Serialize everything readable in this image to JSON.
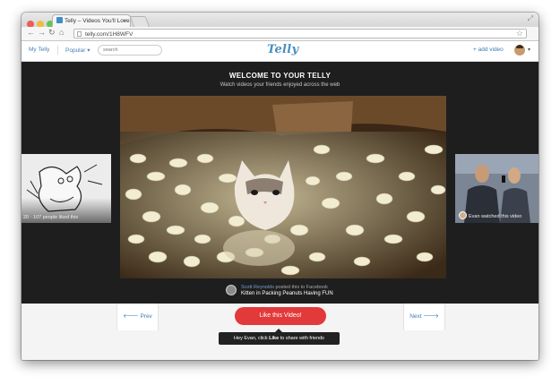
{
  "browser": {
    "tab_title": "Telly – Videos You'll Love",
    "url": "telly.com/1H8WFV"
  },
  "nav": {
    "my_telly": "My Telly",
    "popular": "Popular",
    "search_placeholder": "search",
    "logo": "Telly",
    "add_video": "+ add video"
  },
  "hero": {
    "title": "WELCOME TO YOUR TELLY",
    "subtitle": "Watch videos your friends enjoyed across the web"
  },
  "left_thumb": {
    "caption": "20 · 107 people liked this"
  },
  "right_thumb": {
    "caption": "Evan watched this video"
  },
  "video": {
    "poster": "Scott Reynolds",
    "posted_text": " posted this to Facebook",
    "title": "Kitten in Packing Peanuts Having FUN"
  },
  "controls": {
    "prev": "Prev",
    "next": "Next",
    "like": "Like this Video!",
    "tip_before": "Hey Evan, click ",
    "tip_bold": "Like",
    "tip_after": " to share with friends"
  },
  "colors": {
    "accent": "#e2393b",
    "link": "#3d7bb6",
    "stage": "#1e1e1e"
  }
}
